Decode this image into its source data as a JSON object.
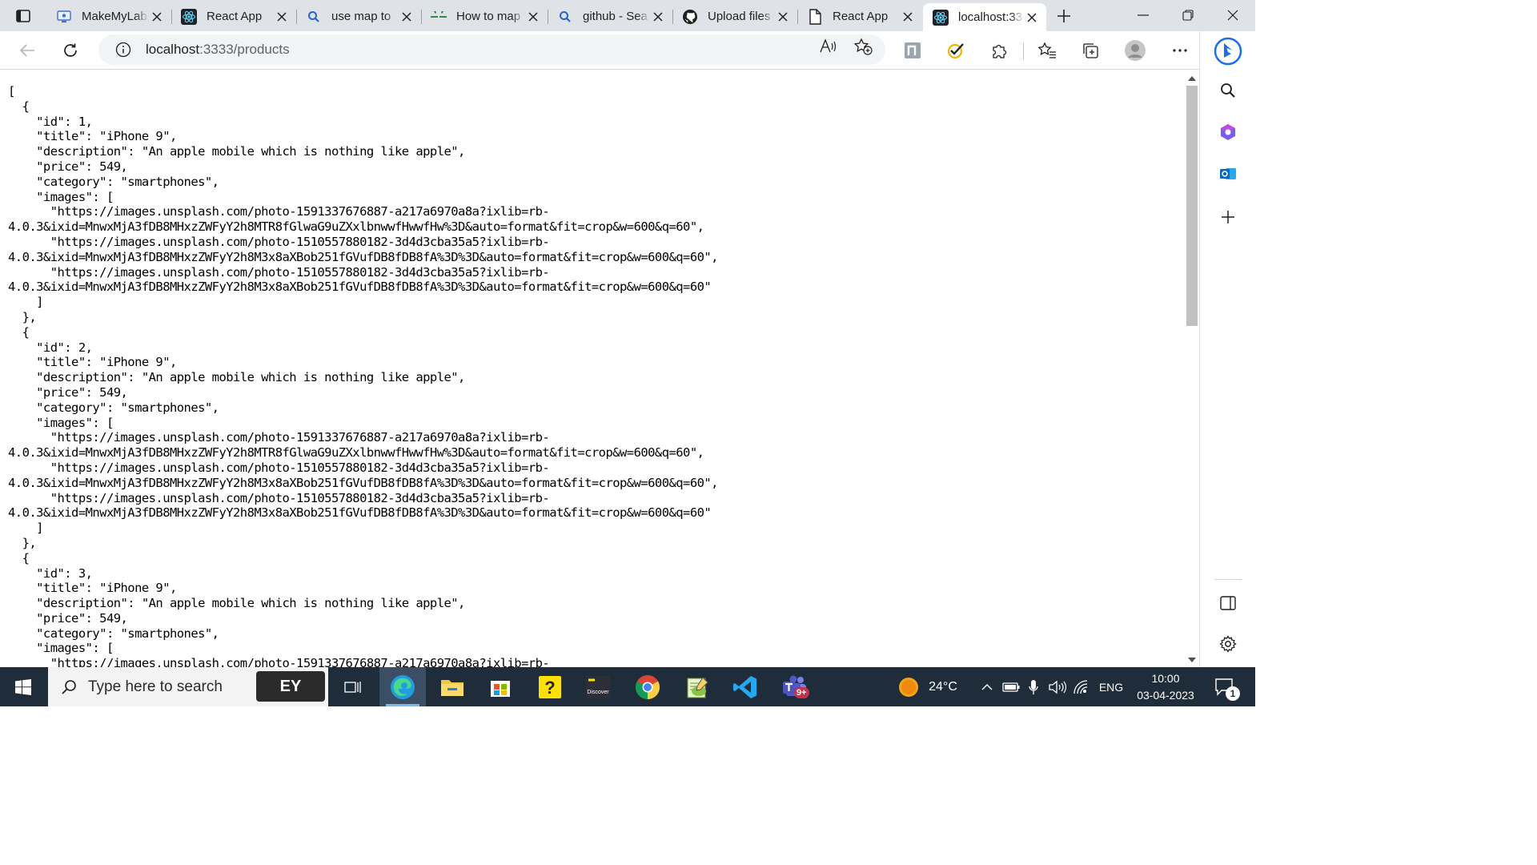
{
  "browser": {
    "tabs": [
      {
        "label": "MakeMyLab",
        "icon": "remote-desktop-icon"
      },
      {
        "label": "React App",
        "icon": "react-icon"
      },
      {
        "label": "use map to",
        "icon": "search-icon"
      },
      {
        "label": "How to map",
        "icon": "geeksforgeeks-icon"
      },
      {
        "label": "github - Sea",
        "icon": "search-icon"
      },
      {
        "label": "Upload files",
        "icon": "github-icon"
      },
      {
        "label": "React App",
        "icon": "page-icon"
      },
      {
        "label": "localhost:33",
        "icon": "react-icon",
        "active": true
      }
    ],
    "address": {
      "host": "localhost",
      "rest": ":3333/products"
    }
  },
  "json_text": "[\n  {\n    \"id\": 1,\n    \"title\": \"iPhone 9\",\n    \"description\": \"An apple mobile which is nothing like apple\",\n    \"price\": 549,\n    \"category\": \"smartphones\",\n    \"images\": [\n      \"https://images.unsplash.com/photo-1591337676887-a217a6970a8a?ixlib=rb-\n4.0.3&ixid=MnwxMjA3fDB8MHxzZWFyY2h8MTR8fGlwaG9uZXxlbnwwfHwwfHw%3D&auto=format&fit=crop&w=600&q=60\",\n      \"https://images.unsplash.com/photo-1510557880182-3d4d3cba35a5?ixlib=rb-\n4.0.3&ixid=MnwxMjA3fDB8MHxzZWFyY2h8M3x8aXBob251fGVufDB8fDB8fA%3D%3D&auto=format&fit=crop&w=600&q=60\",\n      \"https://images.unsplash.com/photo-1510557880182-3d4d3cba35a5?ixlib=rb-\n4.0.3&ixid=MnwxMjA3fDB8MHxzZWFyY2h8M3x8aXBob251fGVufDB8fDB8fA%3D%3D&auto=format&fit=crop&w=600&q=60\"\n    ]\n  },\n  {\n    \"id\": 2,\n    \"title\": \"iPhone 9\",\n    \"description\": \"An apple mobile which is nothing like apple\",\n    \"price\": 549,\n    \"category\": \"smartphones\",\n    \"images\": [\n      \"https://images.unsplash.com/photo-1591337676887-a217a6970a8a?ixlib=rb-\n4.0.3&ixid=MnwxMjA3fDB8MHxzZWFyY2h8MTR8fGlwaG9uZXxlbnwwfHwwfHw%3D&auto=format&fit=crop&w=600&q=60\",\n      \"https://images.unsplash.com/photo-1510557880182-3d4d3cba35a5?ixlib=rb-\n4.0.3&ixid=MnwxMjA3fDB8MHxzZWFyY2h8M3x8aXBob251fGVufDB8fDB8fA%3D%3D&auto=format&fit=crop&w=600&q=60\",\n      \"https://images.unsplash.com/photo-1510557880182-3d4d3cba35a5?ixlib=rb-\n4.0.3&ixid=MnwxMjA3fDB8MHxzZWFyY2h8M3x8aXBob251fGVufDB8fDB8fA%3D%3D&auto=format&fit=crop&w=600&q=60\"\n    ]\n  },\n  {\n    \"id\": 3,\n    \"title\": \"iPhone 9\",\n    \"description\": \"An apple mobile which is nothing like apple\",\n    \"price\": 549,\n    \"category\": \"smartphones\",\n    \"images\": [\n      \"https://images.unsplash.com/photo-1591337676887-a217a6970a8a?ixlib=rb-",
  "taskbar": {
    "search_placeholder": "Type here to search",
    "ey_label": "EY",
    "weather": "24°C",
    "language": "ENG",
    "time": "10:00",
    "date": "03-04-2023",
    "teams_badge": "9+",
    "notification_count": "1",
    "ey_discover_label": "Discover"
  }
}
